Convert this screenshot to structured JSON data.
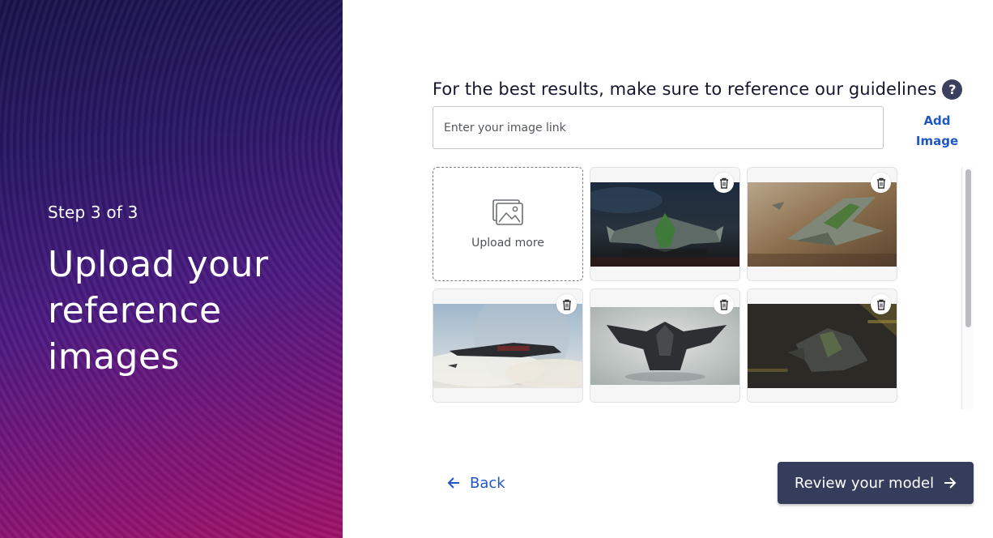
{
  "left": {
    "step": "Step 3 of 3",
    "title": "Upload your reference images"
  },
  "guidelines": {
    "text": "For the best results, make sure to reference our guidelines",
    "help_icon": "?"
  },
  "link_input": {
    "placeholder": "Enter your image link",
    "value": ""
  },
  "add_image": {
    "line1": "Add",
    "line2": "Image"
  },
  "upload": {
    "label": "Upload more",
    "icon": "image-gallery-icon"
  },
  "images": [
    {
      "name": "green-spaceship-front",
      "icon": "trash-icon"
    },
    {
      "name": "green-spaceship-desert",
      "icon": "trash-icon"
    },
    {
      "name": "black-spaceship-clouds",
      "icon": "trash-icon"
    },
    {
      "name": "black-spaceship-studio",
      "icon": "trash-icon"
    },
    {
      "name": "dark-spaceship-hangar",
      "icon": "trash-icon"
    }
  ],
  "footer": {
    "back_label": "Back",
    "review_label": "Review your model"
  },
  "colors": {
    "accent_link": "#1f57c4",
    "primary_button": "#363d5c",
    "help_icon_bg": "#3b4060"
  }
}
